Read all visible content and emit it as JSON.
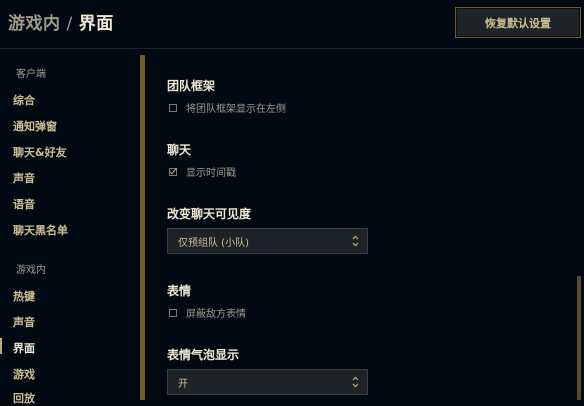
{
  "header": {
    "breadcrumb_parent": "游戏内",
    "breadcrumb_separator": "/",
    "breadcrumb_current": "界面",
    "restore_button": "恢复默认设置"
  },
  "sidebar": {
    "client_section": "客户端",
    "client_items": [
      "综合",
      "通知弹窗",
      "聊天&好友",
      "声音",
      "语音",
      "聊天黑名单"
    ],
    "ingame_section": "游戏内",
    "ingame_items": [
      "热键",
      "声音",
      "界面",
      "游戏",
      "回放"
    ],
    "active_item": "界面"
  },
  "settings": {
    "team_frame": {
      "title": "团队框架",
      "checkbox_label": "将团队框架显示在左侧",
      "checked": false
    },
    "chat": {
      "title": "聊天",
      "checkbox_label": "显示时间戳",
      "checked": true
    },
    "chat_visibility": {
      "title": "改变聊天可见度",
      "selected": "仅预组队 (小队)"
    },
    "emotes": {
      "title": "表情",
      "checkbox_label": "屏蔽敌方表情",
      "checked": false
    },
    "emote_bubble": {
      "title": "表情气泡显示",
      "selected": "开"
    }
  },
  "colors": {
    "background": "#010a13",
    "gold_accent": "#c8aa6e",
    "gold_border": "#785a28",
    "text_light": "#f0e6d2",
    "text_muted": "#a09b8c"
  }
}
